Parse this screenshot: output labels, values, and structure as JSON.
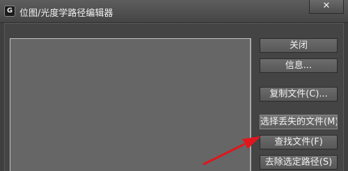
{
  "window": {
    "title": "位图/光度学路径编辑器",
    "close_glyph": "✕",
    "app_icon_glyph": "G"
  },
  "buttons": {
    "close": "关闭",
    "info": "信息...",
    "copy_files": "复制文件(C)...",
    "select_missing": "选择丢失的文件(M)",
    "find_files": "查找文件(F)",
    "strip_path": "去除选定路径(S)"
  },
  "colors": {
    "annotation_arrow": "#e0161c"
  },
  "icons": {
    "window_close": "close-icon",
    "app": "app-icon"
  }
}
